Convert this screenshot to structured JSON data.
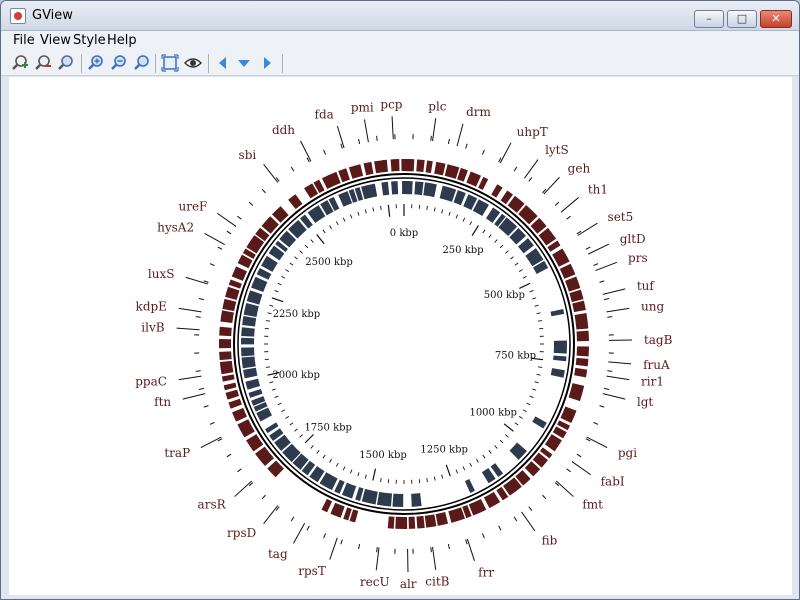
{
  "window": {
    "title": "GView",
    "buttons": {
      "minimize": "–",
      "maximize": "□",
      "close": "✕"
    }
  },
  "menu": {
    "items": [
      "File",
      "View",
      "Style",
      "Help"
    ]
  },
  "toolbar": {
    "buttons": [
      {
        "name": "zoom-in-green-icon",
        "color": "#2e8b3a"
      },
      {
        "name": "zoom-out-red-icon",
        "color": "#c03020"
      },
      {
        "name": "zoom-reset-icon",
        "color": "#3a6fc0"
      },
      {
        "name": "zoom-in-icon",
        "color": "#3a6fc0"
      },
      {
        "name": "zoom-out-icon",
        "color": "#3a6fc0"
      },
      {
        "name": "zoom-normal-icon",
        "color": "#3a6fc0"
      },
      {
        "name": "fit-window-icon",
        "color": "#3a6fc0"
      },
      {
        "name": "eye-icon",
        "color": "#333333"
      },
      {
        "name": "arrow-left-icon",
        "color": "#3a8ad8"
      },
      {
        "name": "arrow-down-icon",
        "color": "#3a8ad8"
      },
      {
        "name": "arrow-right-icon",
        "color": "#3a8ad8"
      }
    ]
  },
  "map": {
    "colors": {
      "forward": "#5a1a1a",
      "reverse": "#2e3a4e",
      "backbone": "#000000",
      "label": "#5b1a1a",
      "tick": "#111111"
    },
    "kbp_labels": [
      {
        "text": "0 kbp",
        "angle": 0
      },
      {
        "text": "250 kbp",
        "angle": 31.8
      },
      {
        "text": "500 kbp",
        "angle": 63.6
      },
      {
        "text": "750 kbp",
        "angle": 95.4
      },
      {
        "text": "1000 kbp",
        "angle": 127.2
      },
      {
        "text": "1250 kbp",
        "angle": 159
      },
      {
        "text": "1500 kbp",
        "angle": 190.8
      },
      {
        "text": "1750 kbp",
        "angle": 222.6
      },
      {
        "text": "2000 kbp",
        "angle": 254.4
      },
      {
        "text": "2250 kbp",
        "angle": 286.2
      },
      {
        "text": "2500 kbp",
        "angle": 318
      }
    ],
    "genes": [
      {
        "label": "pcp",
        "angle": -3
      },
      {
        "label": "plc",
        "angle": 8
      },
      {
        "label": "drm",
        "angle": 15
      },
      {
        "label": "uhpT",
        "angle": 28
      },
      {
        "label": "lytS",
        "angle": 36
      },
      {
        "label": "geh",
        "angle": 43
      },
      {
        "label": "th1",
        "angle": 50
      },
      {
        "label": "set5",
        "angle": 58
      },
      {
        "label": "gltD",
        "angle": 64
      },
      {
        "label": "prs",
        "angle": 69
      },
      {
        "label": "tuf",
        "angle": 76
      },
      {
        "label": "ung",
        "angle": 81
      },
      {
        "label": "tagB",
        "angle": 89
      },
      {
        "label": "fruA",
        "angle": 95
      },
      {
        "label": "rir1",
        "angle": 99
      },
      {
        "label": "lgt",
        "angle": 104
      },
      {
        "label": "pgi",
        "angle": 117
      },
      {
        "label": "fabI",
        "angle": 125
      },
      {
        "label": "fmt",
        "angle": 132
      },
      {
        "label": "fib",
        "angle": 145
      },
      {
        "label": "frr",
        "angle": 162
      },
      {
        "label": "citB",
        "angle": 172
      },
      {
        "label": "alr",
        "angle": 179
      },
      {
        "label": "recU",
        "angle": 187
      },
      {
        "label": "rpsT",
        "angle": 199
      },
      {
        "label": "tag",
        "angle": 209
      },
      {
        "label": "rpsD",
        "angle": 218
      },
      {
        "label": "arsR",
        "angle": 228
      },
      {
        "label": "traP",
        "angle": 243
      },
      {
        "label": "ftn",
        "angle": 256
      },
      {
        "label": "ppaC",
        "angle": 261
      },
      {
        "label": "ilvB",
        "angle": 274
      },
      {
        "label": "kdpE",
        "angle": 279
      },
      {
        "label": "luxS",
        "angle": 287
      },
      {
        "label": "hysA2",
        "angle": 299
      },
      {
        "label": "ureF",
        "angle": 305
      },
      {
        "label": "sbi",
        "angle": 322
      },
      {
        "label": "ddh",
        "angle": 333
      },
      {
        "label": "fda",
        "angle": 343
      },
      {
        "label": "pmi",
        "angle": 350
      }
    ]
  }
}
